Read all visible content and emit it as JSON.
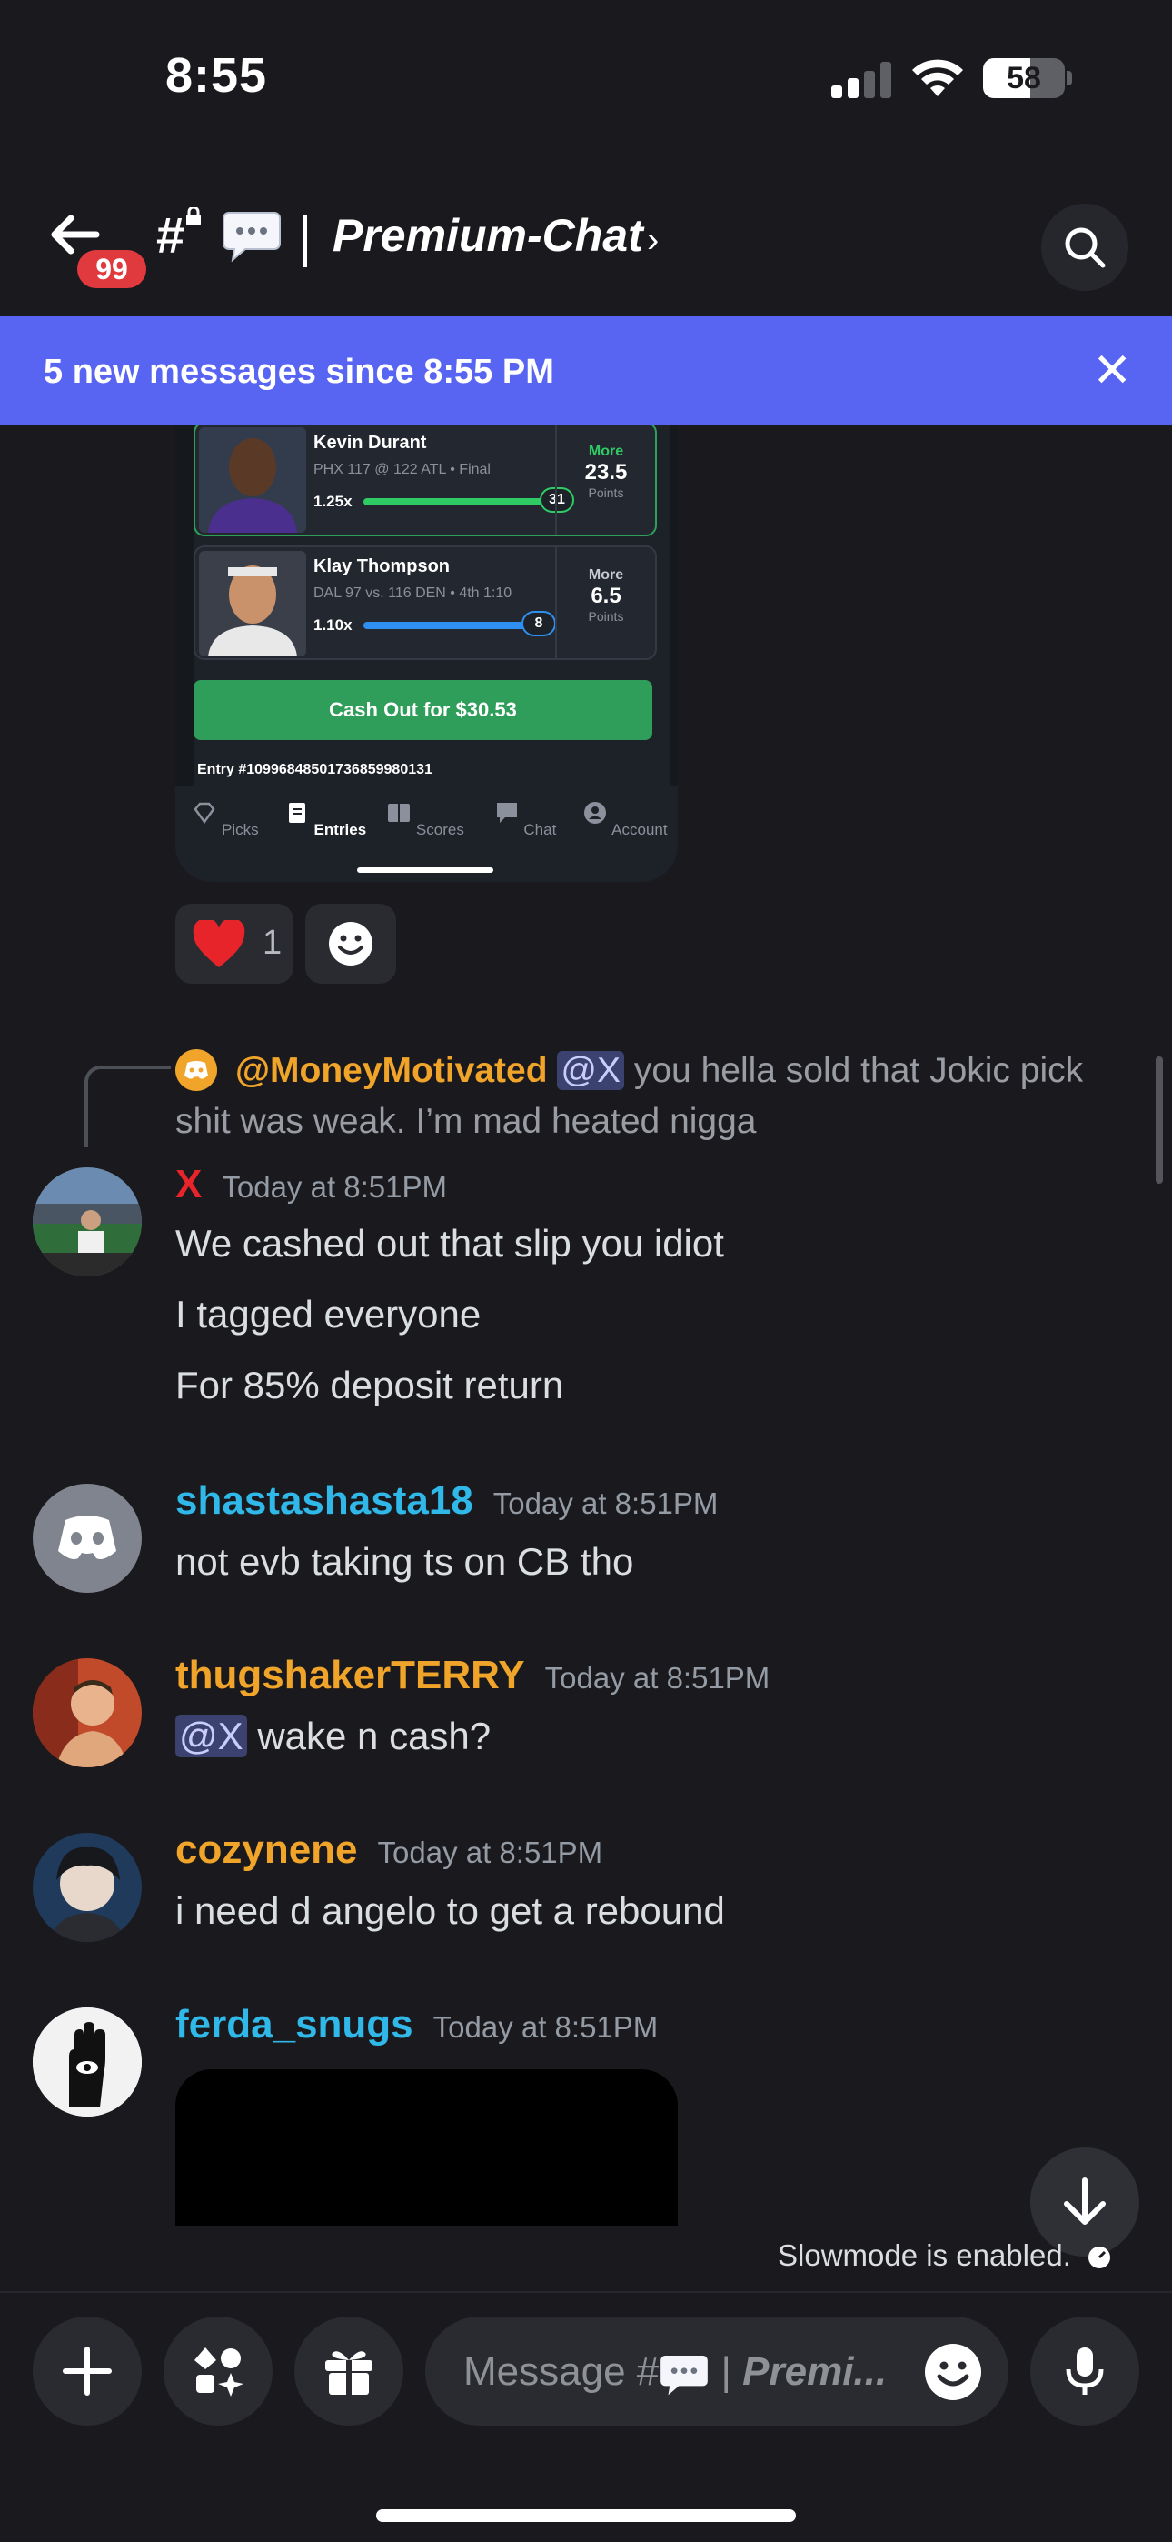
{
  "status_bar": {
    "time": "8:55",
    "battery": "58"
  },
  "header": {
    "unread_badge": "99",
    "hash": "#",
    "separator": "|",
    "channel_name": "Premium-Chat",
    "chevron": "›"
  },
  "new_messages_bar": {
    "text": "5 new messages since 8:55 PM",
    "close": "✕"
  },
  "embed": {
    "players": [
      {
        "name": "Kevin Durant",
        "game": "PHX 117 @ 122 ATL • Final",
        "multiplier": "1.25x",
        "progress_value": "31",
        "direction": "More",
        "line": "23.5",
        "unit": "Points",
        "progress_fraction": 1.0,
        "color": "#2fcc66"
      },
      {
        "name": "Klay Thompson",
        "game": "DAL 97 vs. 116 DEN • 4th 1:10",
        "multiplier": "1.10x",
        "progress_value": "8",
        "direction": "More",
        "line": "6.5",
        "unit": "Points",
        "progress_fraction": 0.9,
        "color": "#2f8ff0"
      }
    ],
    "cashout_label": "Cash Out for $30.53",
    "entry_id": "Entry #10996848501736859980131",
    "tabs": [
      "Picks",
      "Entries",
      "Scores",
      "Chat",
      "Account"
    ],
    "active_tab": "Entries"
  },
  "reactions": {
    "heart_count": "1"
  },
  "reply": {
    "author": "@MoneyMotivated",
    "mention": "@X",
    "text": " you hella sold that Jokic pick shit was weak. I’m mad heated nigga"
  },
  "messages": [
    {
      "author": "X",
      "time": "Today at 8:51PM",
      "color": "#e8242b",
      "lines": [
        "We cashed out that slip you idiot",
        "I tagged everyone",
        "For 85% deposit return"
      ]
    },
    {
      "author": "shastashasta18",
      "time": "Today at 8:51PM",
      "color": "#2fb8e8",
      "lines": [
        "not evb taking ts on CB tho"
      ]
    },
    {
      "author": "thugshakerTERRY",
      "time": "Today at 8:51PM",
      "color": "#f0a42a",
      "mention": "@X",
      "lines": [
        " wake n cash?"
      ]
    },
    {
      "author": "cozynene",
      "time": "Today at 8:51PM",
      "color": "#f0a42a",
      "lines": [
        "i need d angelo to get a rebound"
      ]
    },
    {
      "author": "ferda_snugs",
      "time": "Today at 8:51PM",
      "color": "#2fb8e8",
      "lines": []
    }
  ],
  "slowmode": "Slowmode is enabled.",
  "composer": {
    "placeholder_prefix": "Message #",
    "placeholder_channel": "Premi..."
  },
  "colors": {
    "accent": "#5865f2",
    "background": "#1a1a1e",
    "badge": "#e03a3e"
  }
}
